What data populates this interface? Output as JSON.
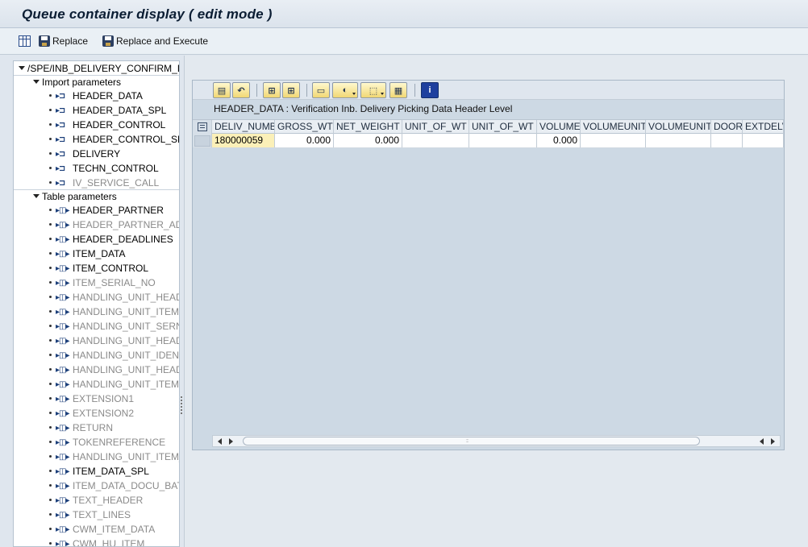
{
  "window": {
    "title": "Queue container display ( edit mode )"
  },
  "toolbar": {
    "grid_icon": "display-change-icon",
    "replace_label": "Replace",
    "replace_execute_label": "Replace and Execute"
  },
  "tree": {
    "root_label": "/SPE/INB_DELIVERY_CONFIRM_DEC",
    "import_section": "Import parameters",
    "import_items": [
      {
        "label": "HEADER_DATA",
        "dim": false
      },
      {
        "label": "HEADER_DATA_SPL",
        "dim": false
      },
      {
        "label": "HEADER_CONTROL",
        "dim": false
      },
      {
        "label": "HEADER_CONTROL_SPL",
        "dim": false
      },
      {
        "label": "DELIVERY",
        "dim": false
      },
      {
        "label": "TECHN_CONTROL",
        "dim": false
      },
      {
        "label": "IV_SERVICE_CALL",
        "dim": true
      }
    ],
    "table_section": "Table parameters",
    "table_items": [
      {
        "label": "HEADER_PARTNER",
        "dim": false
      },
      {
        "label": "HEADER_PARTNER_ADDR",
        "dim": true
      },
      {
        "label": "HEADER_DEADLINES",
        "dim": false
      },
      {
        "label": "ITEM_DATA",
        "dim": false
      },
      {
        "label": "ITEM_CONTROL",
        "dim": false
      },
      {
        "label": "ITEM_SERIAL_NO",
        "dim": true
      },
      {
        "label": "HANDLING_UNIT_HEADER",
        "dim": true
      },
      {
        "label": "HANDLING_UNIT_ITEM",
        "dim": true
      },
      {
        "label": "HANDLING_UNIT_SERNO",
        "dim": true
      },
      {
        "label": "HANDLING_UNIT_HEADER",
        "dim": true
      },
      {
        "label": "HANDLING_UNIT_IDENT",
        "dim": true
      },
      {
        "label": "HANDLING_UNIT_HEADER",
        "dim": true
      },
      {
        "label": "HANDLING_UNIT_ITEMS",
        "dim": true
      },
      {
        "label": "EXTENSION1",
        "dim": true
      },
      {
        "label": "EXTENSION2",
        "dim": true
      },
      {
        "label": "RETURN",
        "dim": true
      },
      {
        "label": "TOKENREFERENCE",
        "dim": true
      },
      {
        "label": "HANDLING_UNIT_ITEM_",
        "dim": true
      },
      {
        "label": "ITEM_DATA_SPL",
        "dim": false
      },
      {
        "label": "ITEM_DATA_DOCU_BATCH",
        "dim": true
      },
      {
        "label": "TEXT_HEADER",
        "dim": true
      },
      {
        "label": "TEXT_LINES",
        "dim": true
      },
      {
        "label": "CWM_ITEM_DATA",
        "dim": true
      },
      {
        "label": "CWM_HU_ITEM",
        "dim": true
      }
    ]
  },
  "alv": {
    "caption": "HEADER_DATA : Verification Inb. Delivery Picking Data Header Level",
    "columns": [
      "DELIV_NUMB",
      "GROSS_WT",
      "NET_WEIGHT",
      "UNIT_OF_WT",
      "UNIT_OF_WT",
      "VOLUME",
      "VOLUMEUNIT",
      "VOLUMEUNIT",
      "DOOR",
      "EXTDELV"
    ],
    "rows": [
      [
        "180000059",
        "0.000",
        "0.000",
        "",
        "",
        "0.000",
        "",
        "",
        "",
        ""
      ]
    ],
    "buttons": [
      "details-icon",
      "choose-icon",
      "find-icon",
      "find-next-icon",
      "print-icon",
      "views-icon",
      "export-icon",
      "layout-icon",
      "info-icon"
    ],
    "button_glyphs": [
      "▤",
      "↶",
      "⊞",
      "⊞",
      "▭",
      "◐",
      "⬚",
      "▦",
      "i"
    ]
  },
  "colors": {
    "accent": "#f1d774",
    "key_cell": "#fbf0b8",
    "panel_bg": "#cdd9e4"
  }
}
